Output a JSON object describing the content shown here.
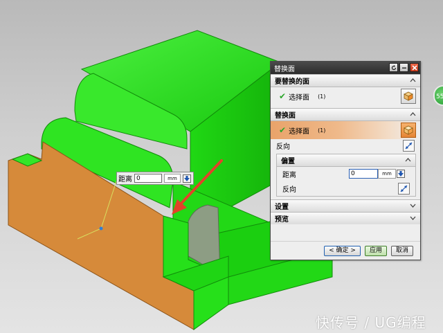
{
  "float_input": {
    "label": "距离",
    "value": "0",
    "unit": "mm"
  },
  "dialog": {
    "title": "替换面",
    "section1": {
      "title": "要替换的面",
      "select_label": "选择面",
      "select_count": "(1)"
    },
    "section2": {
      "title": "替换面",
      "select_label": "选择面",
      "select_count": "(1)",
      "reverse_label": "反向"
    },
    "offset": {
      "title": "偏置",
      "distance_label": "距离",
      "distance_value": "0",
      "distance_unit": "mm",
      "reverse_label": "反向"
    },
    "settings_label": "设置",
    "preview_label": "预览",
    "buttons": {
      "ok": "< 确定 >",
      "apply": "应用",
      "cancel": "取消"
    }
  },
  "side_badge": "55",
  "watermark": "快传号 / UG编程",
  "colors": {
    "model_green": "#26e01a",
    "model_orange": "#d68a3a",
    "arrow_red": "#e2432a",
    "highlight_orange": "#e9a36a"
  }
}
